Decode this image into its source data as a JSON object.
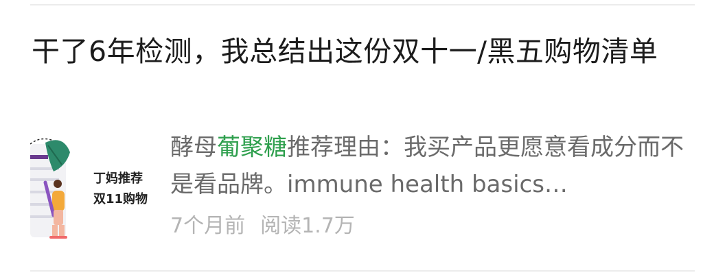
{
  "article": {
    "title": "干了6年检测，我总结出这份双十一/黑五购物清单",
    "thumbnail": {
      "line1": "丁妈推荐",
      "line2": "双11购物"
    },
    "summary_prefix": "酵母",
    "summary_keyword": "葡聚糖",
    "summary_rest": "推荐理由：我买产品更愿意看成分而不是看品牌。immune health basics…",
    "time_ago": "7个月前",
    "reads": "阅读1.7万"
  },
  "colors": {
    "keyword": "#2e9f4d",
    "meta_text": "#b4b4b4",
    "summary_text": "#6a6a6a"
  }
}
